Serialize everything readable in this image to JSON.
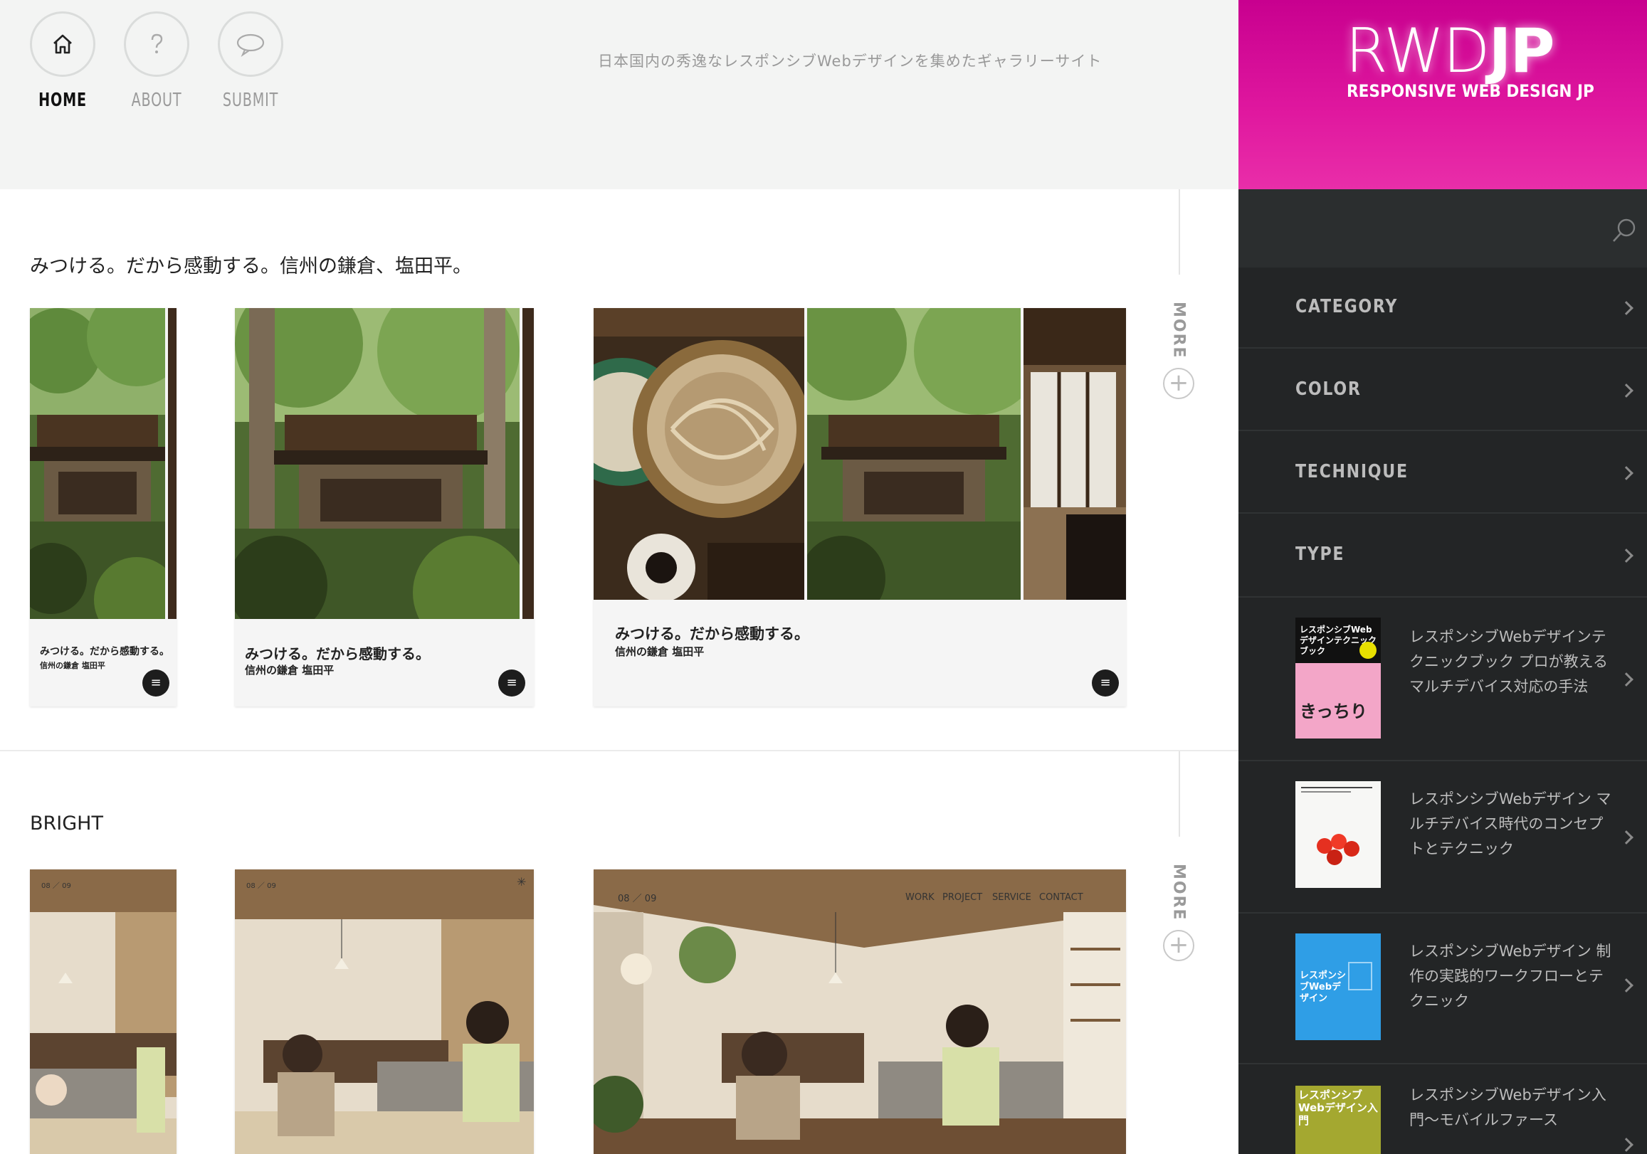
{
  "header": {
    "nav": [
      {
        "label": "HOME",
        "icon": "home-icon",
        "active": true
      },
      {
        "label": "ABOUT",
        "icon": "question-icon",
        "active": false
      },
      {
        "label": "SUBMIT",
        "icon": "speech-bubble-icon",
        "active": false
      }
    ],
    "tagline": "日本国内の秀逸なレスポンシブWebデザインを集めたギャラリーサイト"
  },
  "logo": {
    "main_light": "RWD",
    "main_bold": "JP",
    "sub": "RESPONSIVE WEB DESIGN JP"
  },
  "colors": {
    "brand_pink": "#d9109a",
    "sidebar_bg": "#232526",
    "header_bg": "#f3f4f3"
  },
  "sections": [
    {
      "title": "みつける。だから感動する。信州の鎌倉、塩田平。",
      "more_label": "MORE",
      "caption_title": "みつける。だから感動する。",
      "caption_sub": "信州の鎌倉 塩田平"
    },
    {
      "title": "BRIGHT",
      "more_label": "MORE",
      "slide_counter": "08 ／ 09",
      "site_nav": [
        "WORK",
        "PROJECT",
        "SERVICE",
        "CONTACT"
      ]
    }
  ],
  "sidebar": {
    "search_placeholder": "",
    "menu": [
      "CATEGORY",
      "COLOR",
      "TECHNIQUE",
      "TYPE"
    ],
    "books": [
      {
        "title": "レスポンシブWebデザインテクニックブック プロが教えるマルチデバイス対応の手法"
      },
      {
        "title": "レスポンシブWebデザイン マルチデバイス時代のコンセプトとテクニック"
      },
      {
        "title": "レスポンシブWebデザイン 制作の実践的ワークフローとテクニック"
      },
      {
        "title": "レスポンシブWebデザイン入門〜モバイルファース"
      }
    ],
    "book_cover_text": {
      "b1_title": "レスポンシブWebデザインテクニックブック",
      "b1_accent": "きっちり",
      "b3_title": "レスポンシブWebデザイン",
      "b4_title": "レスポンシブWebデザイン入門"
    }
  }
}
